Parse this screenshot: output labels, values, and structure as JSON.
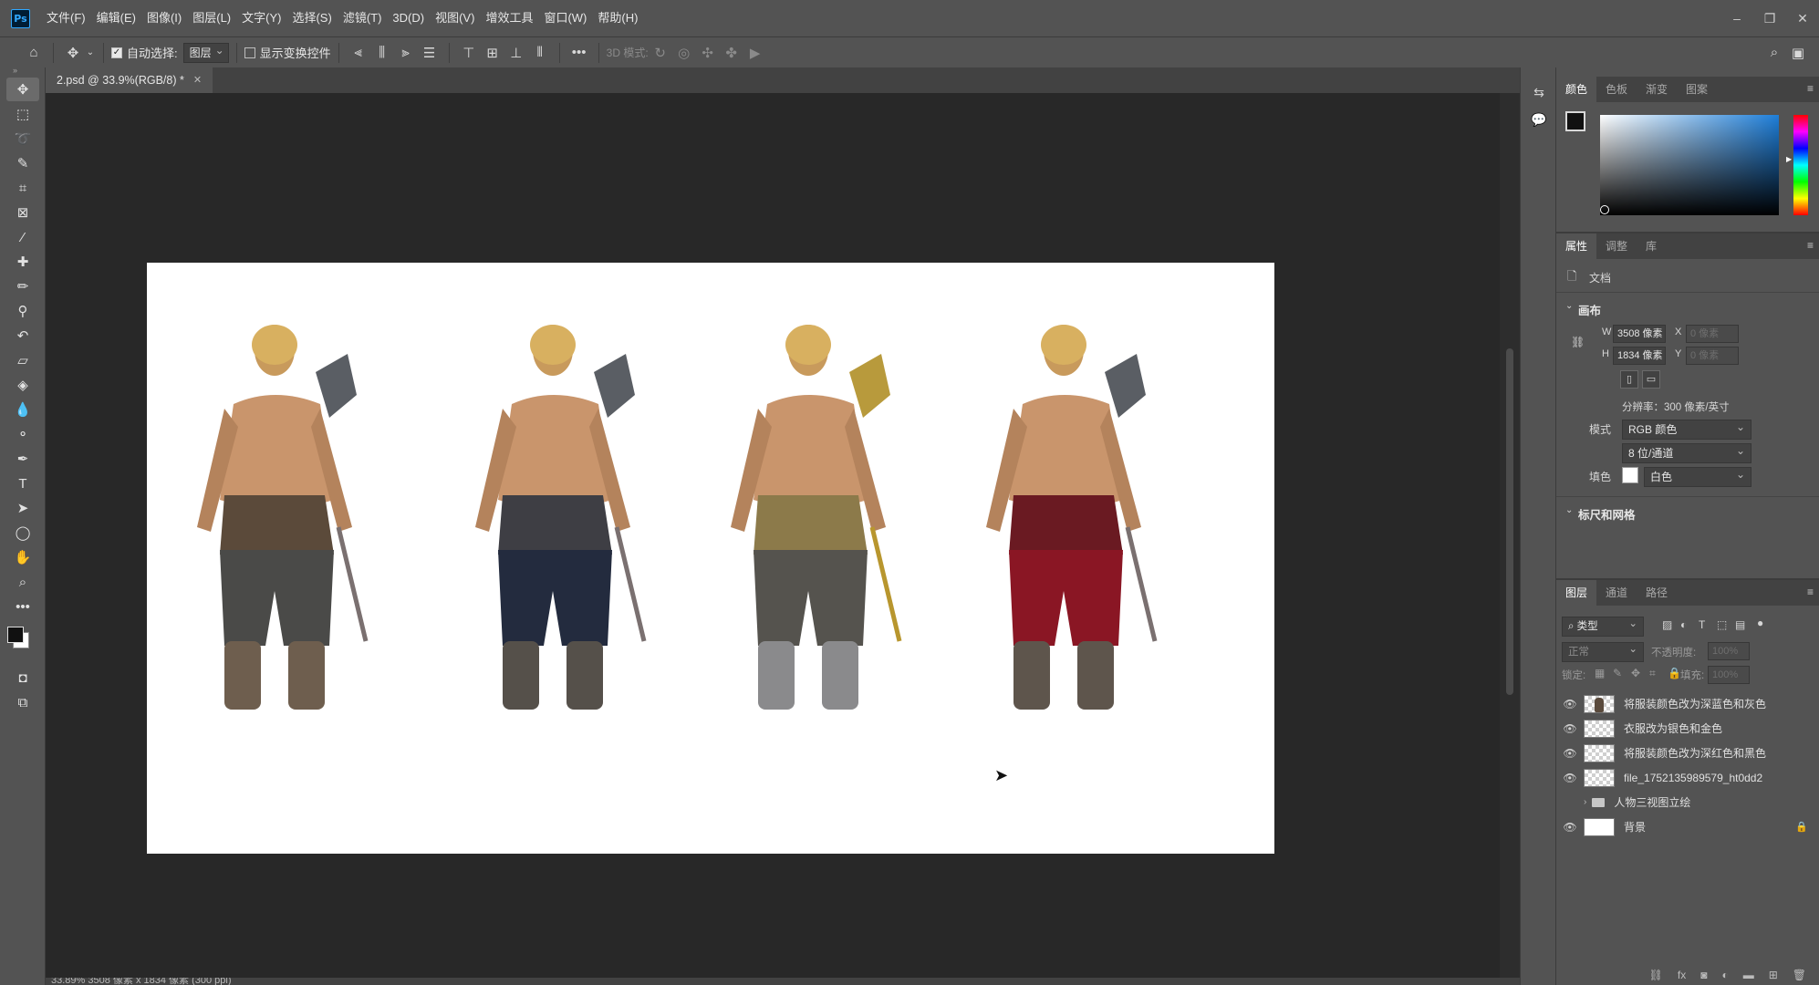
{
  "app": {
    "logo": "Ps"
  },
  "menubar": {
    "items": [
      "文件(F)",
      "编辑(E)",
      "图像(I)",
      "图层(L)",
      "文字(Y)",
      "选择(S)",
      "滤镜(T)",
      "3D(D)",
      "视图(V)",
      "增效工具",
      "窗口(W)",
      "帮助(H)"
    ],
    "window_controls": [
      "minimize-icon",
      "restore-icon",
      "close-icon"
    ]
  },
  "options": {
    "auto_select_label": "自动选择:",
    "auto_select_checked": true,
    "auto_select_target": "图层",
    "show_transform_label": "显示变换控件",
    "show_transform_checked": false,
    "mode_3d_label": "3D 模式:"
  },
  "toolbar": {
    "tools": [
      "move-tool-icon",
      "marquee-tool-icon",
      "lasso-tool-icon",
      "quick-select-tool-icon",
      "crop-tool-icon",
      "frame-tool-icon",
      "eyedropper-tool-icon",
      "healing-brush-tool-icon",
      "brush-tool-icon",
      "clone-stamp-tool-icon",
      "history-brush-tool-icon",
      "eraser-tool-icon",
      "paint-bucket-tool-icon",
      "blur-tool-icon",
      "dodge-tool-icon",
      "pen-tool-icon",
      "type-tool-icon",
      "path-select-tool-icon",
      "ellipse-tool-icon",
      "hand-tool-icon",
      "zoom-tool-icon",
      "more-tools-icon"
    ]
  },
  "document": {
    "tab_title": "2.psd @ 33.9%(RGB/8) *",
    "status": "33.89%    3508 像素 x 1834 像素 (300 ppi)"
  },
  "color_panel": {
    "tabs": [
      "颜色",
      "色板",
      "渐变",
      "图案"
    ],
    "active_tab": "颜色",
    "foreground": "#111111",
    "background": "#ffffff",
    "hue_color": "#1e7ed8"
  },
  "properties_panel": {
    "tabs": [
      "属性",
      "调整",
      "库"
    ],
    "active_tab": "属性",
    "doc_label": "文档",
    "canvas_section": "画布",
    "w_label": "W",
    "w_value": "3508 像素",
    "h_label": "H",
    "h_value": "1834 像素",
    "x_label": "X",
    "x_placeholder": "0 像素",
    "y_label": "Y",
    "y_placeholder": "0 像素",
    "resolution": "分辨率：300 像素/英寸",
    "mode_label": "模式",
    "mode_value": "RGB 颜色",
    "depth_value": "8 位/通道",
    "fill_label": "填色",
    "fill_value": "白色",
    "rulers_section": "标尺和网格"
  },
  "layers_panel": {
    "tabs": [
      "图层",
      "通道",
      "路径"
    ],
    "active_tab": "图层",
    "filter_kind": "类型",
    "blend_mode": "正常",
    "opacity_label": "不透明度:",
    "opacity_value": "100%",
    "lock_label": "锁定:",
    "fill_label": "填充:",
    "fill_value": "100%",
    "layers": [
      {
        "name": "将服装颜色改为深蓝色和灰色",
        "visible": true,
        "type": "image"
      },
      {
        "name": "衣服改为银色和金色",
        "visible": true,
        "type": "image"
      },
      {
        "name": "将服装颜色改为深红色和黑色",
        "visible": true,
        "type": "image"
      },
      {
        "name": "file_1752135989579_ht0dd2",
        "visible": true,
        "type": "image"
      },
      {
        "name": "人物三视图立绘",
        "visible": false,
        "type": "group"
      },
      {
        "name": "背景",
        "visible": true,
        "type": "background",
        "locked": true
      }
    ]
  }
}
